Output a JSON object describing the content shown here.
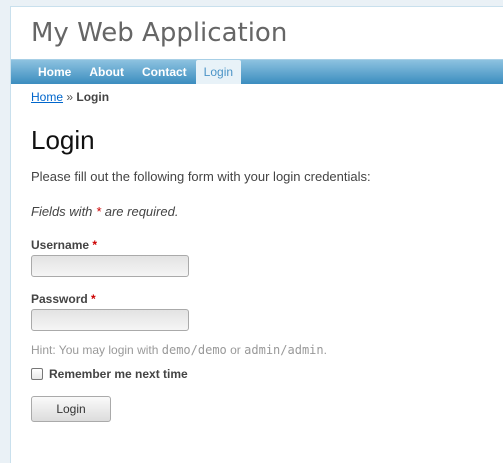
{
  "app": {
    "title": "My Web Application"
  },
  "menu": {
    "items": [
      {
        "label": "Home"
      },
      {
        "label": "About"
      },
      {
        "label": "Contact"
      },
      {
        "label": "Login"
      }
    ],
    "active": "Login"
  },
  "breadcrumbs": {
    "home": "Home",
    "separator": "»",
    "current": "Login"
  },
  "page": {
    "heading": "Login",
    "intro": "Please fill out the following form with your login credentials:",
    "note_prefix": "Fields with",
    "note_star": "*",
    "note_suffix": "are required."
  },
  "form": {
    "username": {
      "label": "Username",
      "required_mark": "*",
      "value": ""
    },
    "password": {
      "label": "Password",
      "required_mark": "*",
      "value": ""
    },
    "hint": {
      "prefix": "Hint: You may login with",
      "cred1": "demo/demo",
      "or": "or",
      "cred2": "admin/admin",
      "suffix": "."
    },
    "remember": {
      "label": "Remember me next time",
      "checked": false
    },
    "submit_label": "Login"
  },
  "colors": {
    "menu_top": "#8dc2e0",
    "menu_bottom": "#3b8dbf",
    "link": "#0066cc",
    "required": "#cc0000"
  }
}
